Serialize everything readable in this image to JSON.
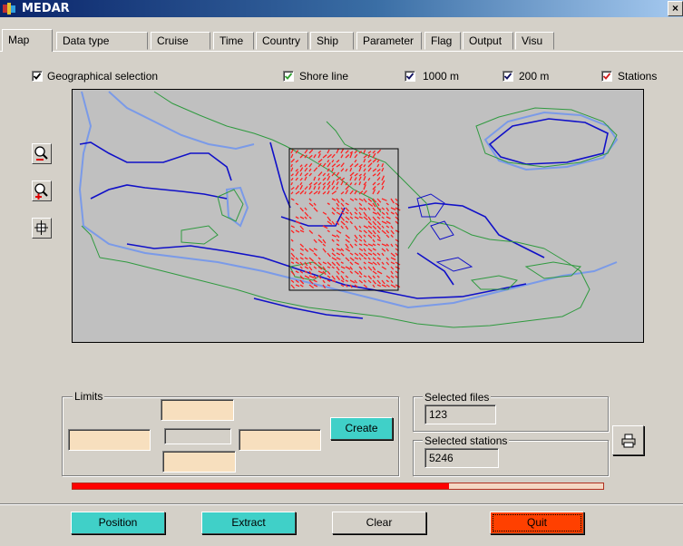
{
  "window": {
    "title": "MEDAR",
    "close_glyph": "×"
  },
  "tabs": [
    {
      "label": "Map",
      "active": true
    },
    {
      "label": "Data type"
    },
    {
      "label": "Cruise"
    },
    {
      "label": "Time"
    },
    {
      "label": "Country"
    },
    {
      "label": "Ship"
    },
    {
      "label": "Parameter"
    },
    {
      "label": "Flag"
    },
    {
      "label": "Output"
    },
    {
      "label": "Visu"
    }
  ],
  "options": {
    "geographical_selection": {
      "label": "Geographical selection",
      "checked": true
    },
    "shore_line": {
      "label": "Shore line",
      "checked": true,
      "color": "#30a030"
    },
    "isobath_1000": {
      "label": "1000 m",
      "checked": true
    },
    "isobath_200": {
      "label": "200 m",
      "checked": true
    },
    "stations": {
      "label": "Stations",
      "checked": true,
      "color": "#d02020"
    }
  },
  "tools": [
    "zoom-out-icon",
    "zoom-in-icon",
    "pan-crosshair-icon"
  ],
  "limits": {
    "title": "Limits",
    "north": "",
    "south": "",
    "west": "",
    "east": "",
    "center": "",
    "create_label": "Create"
  },
  "selected_files": {
    "title": "Selected files",
    "value": "123"
  },
  "selected_stations": {
    "title": "Selected stations",
    "value": "5246"
  },
  "print_icon": "printer-icon",
  "progress": {
    "fraction": 0.71,
    "color": "#ff0000"
  },
  "buttons": {
    "position": {
      "label": "Position",
      "color": "#40d0c8"
    },
    "extract": {
      "label": "Extract",
      "color": "#40d0c8"
    },
    "clear": {
      "label": "Clear",
      "color": "#d4d0c8"
    },
    "quit": {
      "label": "Quit",
      "color": "#ff4000"
    }
  },
  "colors": {
    "shore": "#30a030",
    "isobath_1000": "#1010c0",
    "isobath_200": "#6a8ae0",
    "stations": "#ff2020"
  }
}
